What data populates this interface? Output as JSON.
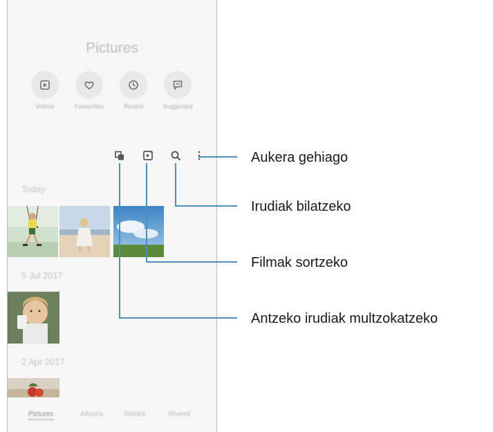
{
  "app": {
    "title": "Pictures"
  },
  "quick_access": [
    {
      "label": "Videos",
      "icon": "video-icon"
    },
    {
      "label": "Favourites",
      "icon": "heart-icon"
    },
    {
      "label": "Recent",
      "icon": "clock-icon"
    },
    {
      "label": "Suggested",
      "icon": "suggested-icon"
    }
  ],
  "toolbar": {
    "group_icon": "group-similar-icon",
    "create_icon": "create-movie-icon",
    "search_icon": "search-icon",
    "more_icon": "more-options-icon"
  },
  "sections": [
    {
      "label": "Today"
    },
    {
      "label": "5 Jul 2017"
    },
    {
      "label": "2 Apr 2017"
    }
  ],
  "bottom_nav": [
    {
      "label": "Pictures",
      "active": true
    },
    {
      "label": "Albums",
      "active": false
    },
    {
      "label": "Stories",
      "active": false
    },
    {
      "label": "Shared",
      "active": false
    }
  ],
  "callouts": {
    "more_options": "Aukera gehiago",
    "search": "Irudiak bilatzeko",
    "create_movie": "Filmak sortzeko",
    "group_similar": "Antzeko irudiak multzokatzeko"
  },
  "colors": {
    "screen_bg": "#f6f6f6",
    "leader_line": "#4a90b8",
    "icon_dark": "#555555"
  }
}
